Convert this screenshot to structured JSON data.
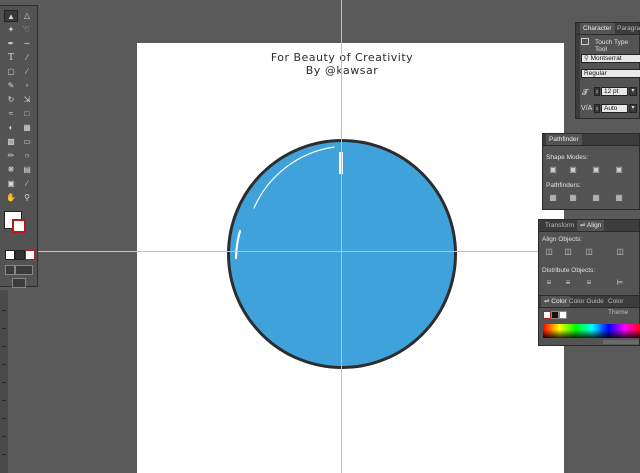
{
  "artboard": {
    "title": "For Beauty of Creativity",
    "subtitle": "By @kawsar"
  },
  "colors": {
    "canvas": "#5a5a5a",
    "circle_fill": "#40a2db",
    "circle_stroke": "#2d2d2d",
    "guide": "#6fe4f0"
  },
  "toolbox": {
    "tools": [
      "selection-tool",
      "direct-selection-tool",
      "magic-wand-tool",
      "lasso-tool",
      "pen-tool",
      "curvature-tool",
      "type-tool",
      "line-tool",
      "rectangle-tool",
      "paintbrush-tool",
      "pencil-tool",
      "eraser-tool",
      "rotate-tool",
      "scale-tool",
      "warp-tool",
      "free-transform-tool",
      "shape-builder-tool",
      "perspective-tool",
      "mesh-tool",
      "gradient-tool",
      "eyedropper-tool",
      "blend-tool",
      "symbol-sprayer-tool",
      "graph-tool",
      "artboard-tool",
      "slice-tool",
      "hand-tool",
      "zoom-tool"
    ]
  },
  "character_panel": {
    "tab_character": "Character",
    "tab_paragraph": "Paragra",
    "touch_type": "Touch Type Tool",
    "font_family": "Montserrat",
    "font_style": "Regular",
    "font_size": "12 pt",
    "tracking": "Auto"
  },
  "pathfinder_panel": {
    "tab": "Pathfinder",
    "shape_modes": "Shape Modes:",
    "pathfinders": "Pathfinders:"
  },
  "align_panel": {
    "tab_transform": "Transform",
    "tab_align": "Align",
    "align_objects": "Align Objects:",
    "distribute_objects": "Distribute Objects:"
  },
  "color_panel": {
    "tab_color": "Color",
    "tab_color_guide": "Color Guide",
    "tab_color_themes": "Color Theme"
  }
}
